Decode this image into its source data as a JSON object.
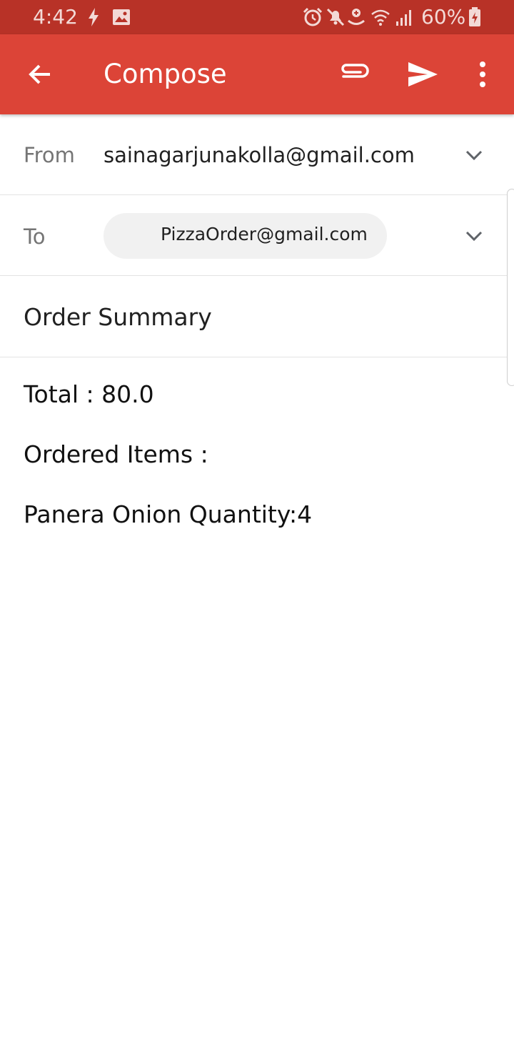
{
  "status_bar": {
    "time": "4:42",
    "battery": "60%"
  },
  "app_bar": {
    "title": "Compose",
    "color": "#dc4437"
  },
  "from": {
    "label": "From",
    "value": "sainagarjunakolla@gmail.com"
  },
  "to": {
    "label": "To",
    "chip": "PizzaOrder@gmail.com"
  },
  "subject": "Order Summary",
  "body": {
    "lines": [
      "Total : 80.0",
      "Ordered Items :",
      "Panera Onion Quantity:4"
    ]
  },
  "icons": {
    "status": [
      "flash-icon",
      "image-icon",
      "alarm-icon",
      "mute-icon",
      "hotspot-icon",
      "wifi-icon",
      "signal-icon",
      "battery-charging-icon"
    ],
    "app_bar": [
      "back-arrow-icon",
      "attach-icon",
      "send-icon",
      "more-vert-icon"
    ]
  }
}
